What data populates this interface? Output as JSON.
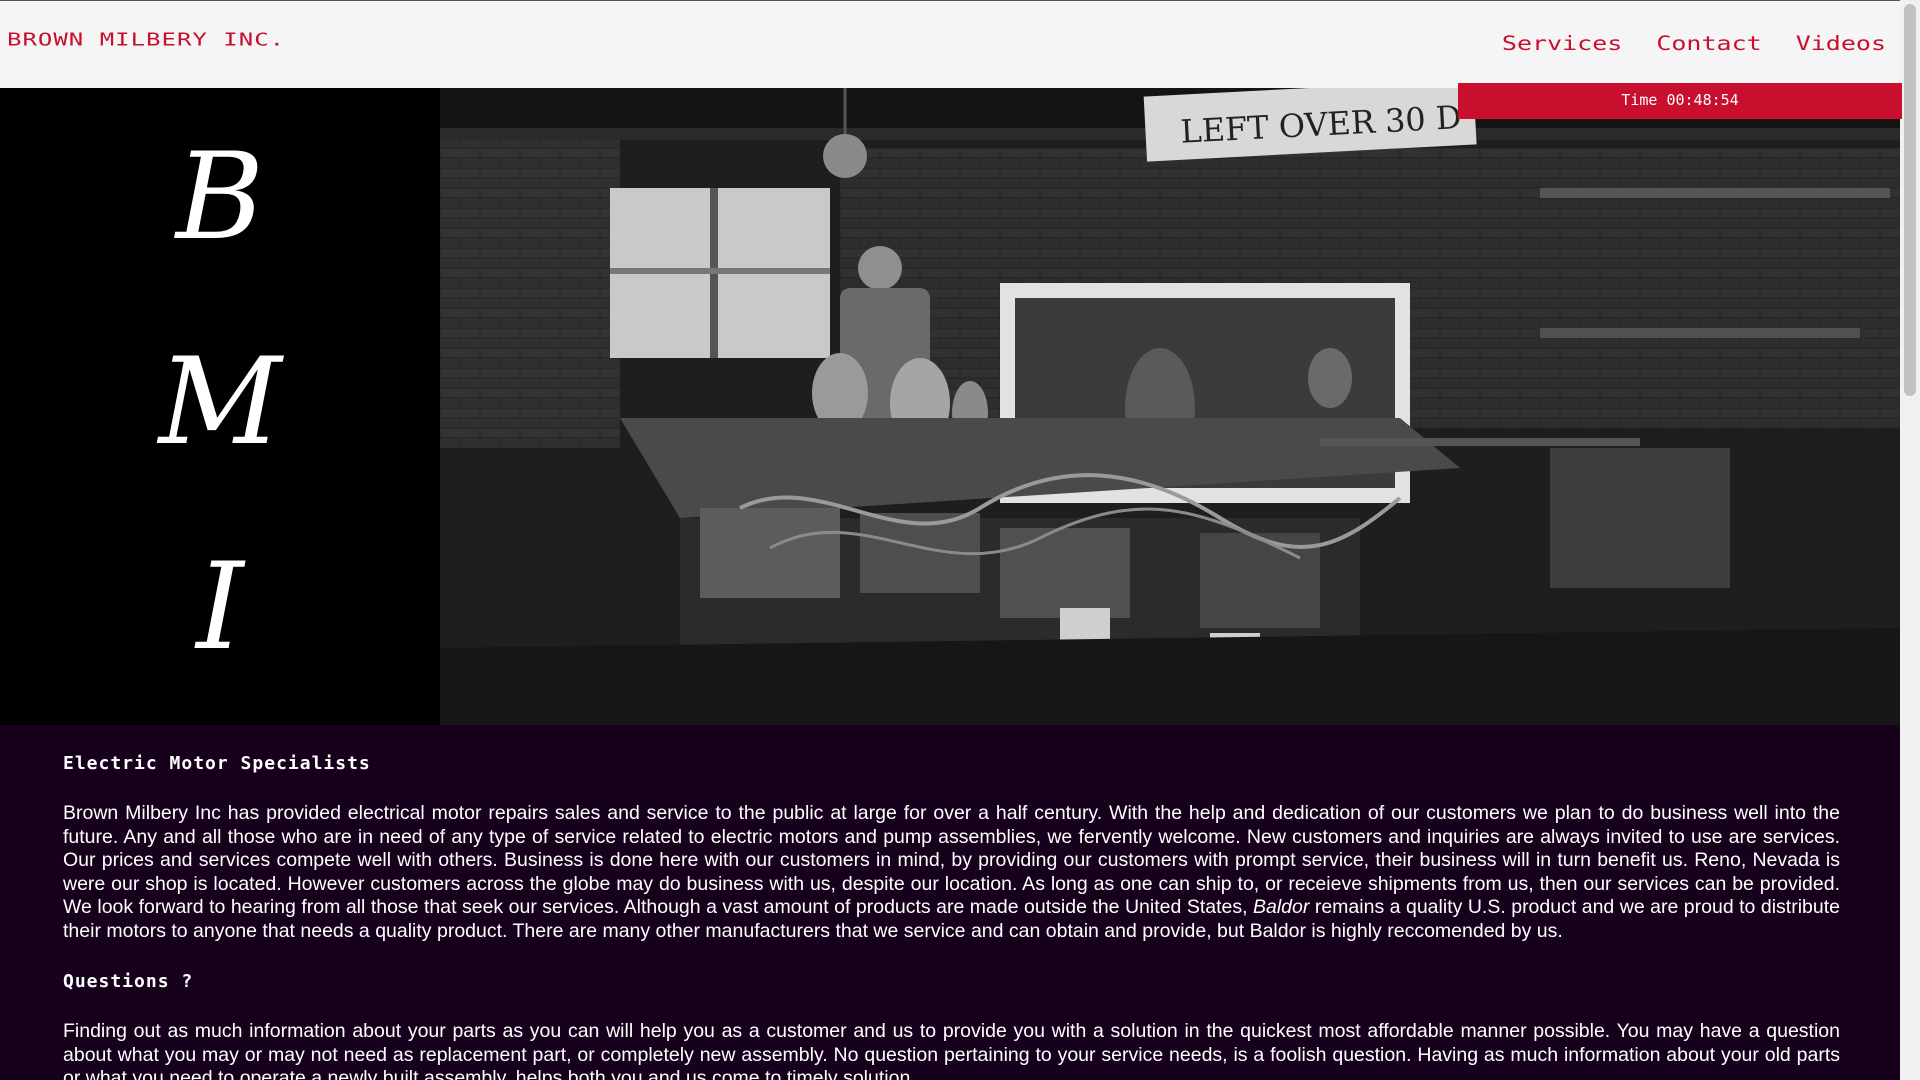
{
  "header": {
    "brand": "BROWN MILBERY INC.",
    "nav": [
      "Services",
      "Contact",
      "Videos"
    ],
    "time_label": "Time 00:48:54"
  },
  "hero": {
    "letters": [
      "B",
      "M",
      "I"
    ],
    "photo_sign": "LEFT OVER 30 D"
  },
  "content": {
    "heading1": "Electric Motor Specialists",
    "para1_a": "Brown Milbery Inc has provided electrical motor repairs sales and service to the public at large for over a half century. With the help and dedication of our customers we plan to do business well into the future. Any and all those who are in need of any type of service related to electric motors and pump assemblies, we fervently welcome. New customers and inquiries are always invited to use are services. Our prices and services compete well with others. Business is done here with our customers in mind, by providing our customers with prompt service, their business will in turn benefit us. Reno, Nevada is were our shop is located. However customers across the globe may do business with us, despite our location. As long as one can ship to, or receieve shipments from us, then our services can be provided. We look forward to hearing from all those that seek our services. Although a vast amount of products are made outside the United States, ",
    "para1_brand": "Baldor",
    "para1_b": " remains a quality U.S. product and we are proud to distribute their motors to anyone that needs a quality product. There are many other manufacturers that we service and can obtain and provide, but Baldor is highly reccomended by us.",
    "heading2": "Questions ?",
    "para2": "Finding out as much information about your parts as you can will help you as a customer and us to provide you with a solution in the quickest most affordable manner possible. You may have a question about what you may or may not need as replacement part, or completely new assembly. No question pertaining to your service needs, is a foolish question. Having as much information about your old parts or what you need to operate a newly built assembly, helps both you and us come to timely solution."
  },
  "colors": {
    "brand_red": "#c8102e",
    "content_bg": "#16001b",
    "header_bg": "#f5f5f5"
  }
}
